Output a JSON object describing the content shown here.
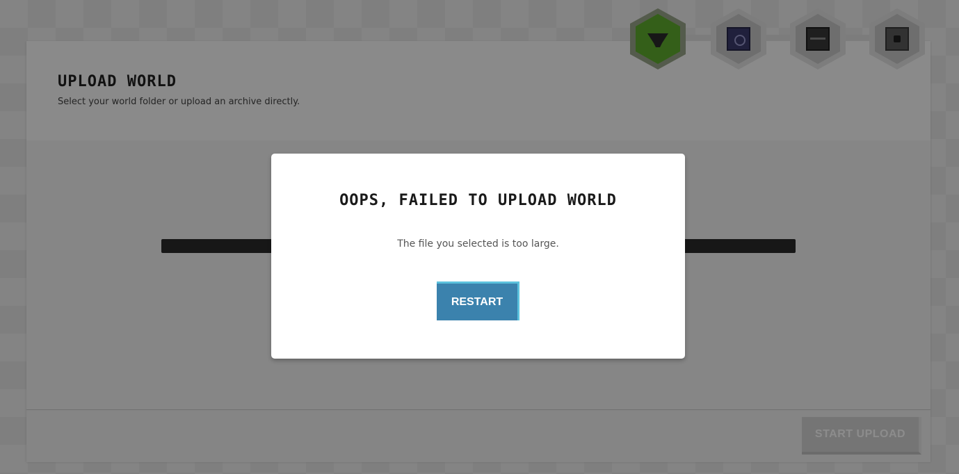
{
  "page": {
    "title": "UPLOAD WORLD",
    "subtitle": "Select your world folder or upload an archive directly.",
    "start_upload_label": "START UPLOAD"
  },
  "steps": [
    {
      "icon": "hopper-block-icon",
      "state": "active"
    },
    {
      "icon": "command-block-icon",
      "state": "inactive"
    },
    {
      "icon": "chest-block-icon",
      "state": "inactive"
    },
    {
      "icon": "dispenser-block-icon",
      "state": "inactive"
    }
  ],
  "modal": {
    "title": "OOPS, FAILED TO UPLOAD WORLD",
    "message": "The file you selected is too large.",
    "restart_label": "RESTART"
  },
  "colors": {
    "active_step": "#5fae2e",
    "restart_button": "#3b82ad",
    "restart_accent": "#5cc2dd"
  }
}
